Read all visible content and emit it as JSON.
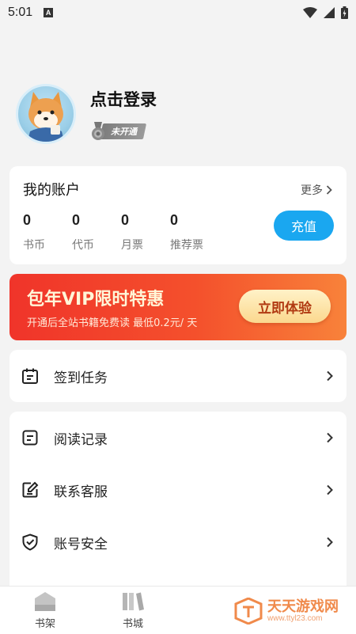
{
  "status_bar": {
    "time": "5:01",
    "notification_icon": "A"
  },
  "profile": {
    "login_label": "点击登录",
    "vip_status": "未开通"
  },
  "account": {
    "title": "我的账户",
    "more_label": "更多",
    "stats": [
      {
        "value": "0",
        "label": "书币"
      },
      {
        "value": "0",
        "label": "代币"
      },
      {
        "value": "0",
        "label": "月票"
      },
      {
        "value": "0",
        "label": "推荐票"
      }
    ],
    "recharge_label": "充值"
  },
  "vip_banner": {
    "headline": "包年VIP限时特惠",
    "subtitle": "开通后全站书籍免费读 最低0.2元/ 天",
    "button_label": "立即体验"
  },
  "menu_groups": [
    {
      "items": [
        {
          "label": "签到任务",
          "icon": "calendar-icon"
        }
      ]
    },
    {
      "items": [
        {
          "label": "阅读记录",
          "icon": "reading-record-icon"
        },
        {
          "label": "联系客服",
          "icon": "edit-icon"
        },
        {
          "label": "账号安全",
          "icon": "shield-check-icon"
        }
      ]
    }
  ],
  "tabbar": {
    "tabs": [
      {
        "label": "书架",
        "icon": "bookshelf-icon"
      },
      {
        "label": "书城",
        "icon": "bookstore-icon"
      }
    ]
  },
  "watermark": {
    "name": "天天游戏网",
    "url": "www.ttyl23.com"
  },
  "colors": {
    "accent_blue": "#1aa7f0",
    "banner_red": "#f0342a",
    "banner_orange": "#f8823a",
    "watermark_orange": "#f08a4b"
  }
}
